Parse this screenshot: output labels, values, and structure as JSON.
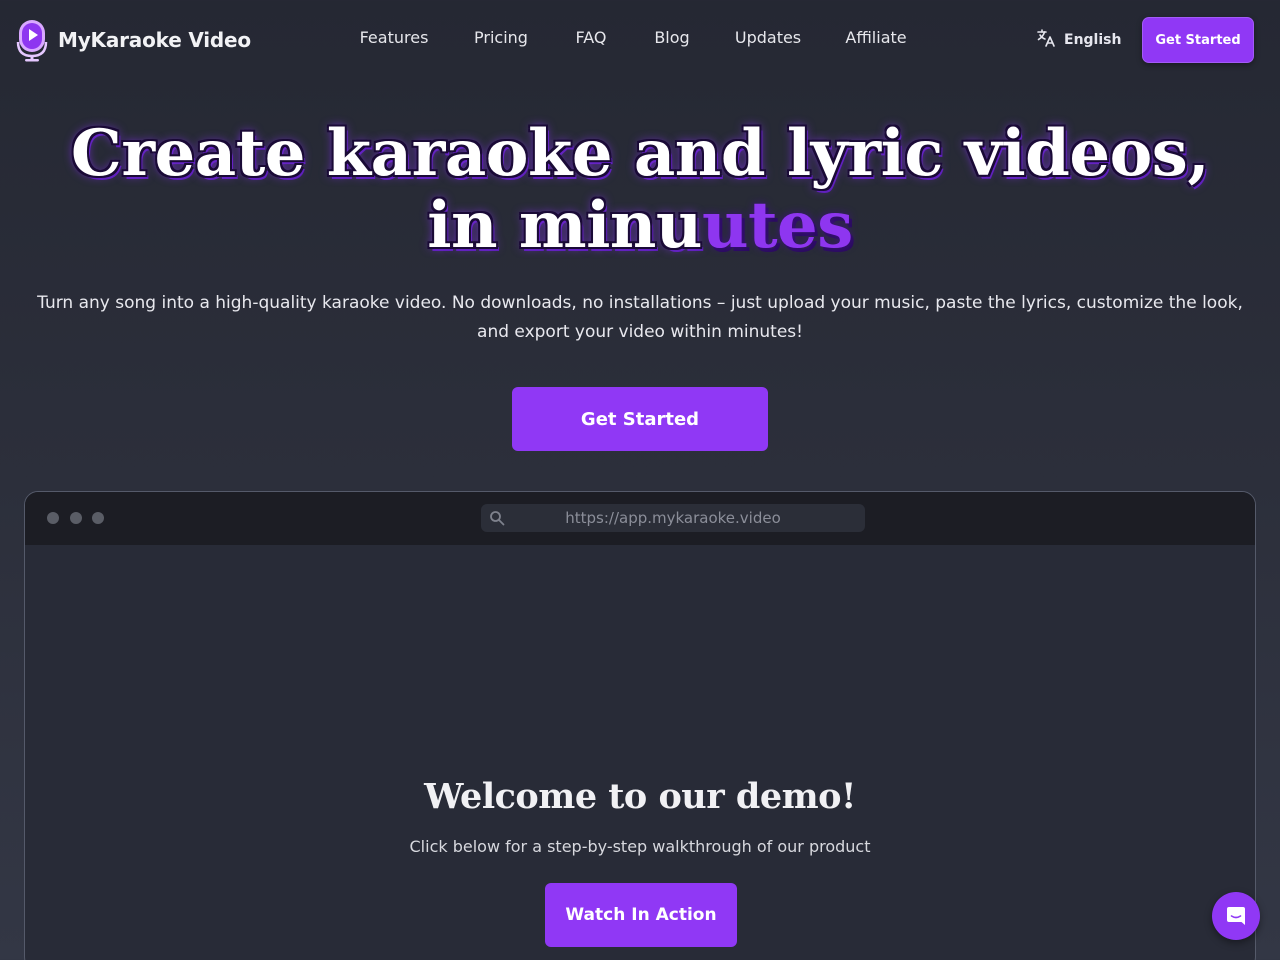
{
  "header": {
    "brand": "MyKaraoke Video",
    "nav": [
      "Features",
      "Pricing",
      "FAQ",
      "Blog",
      "Updates",
      "Affiliate"
    ],
    "language": "English",
    "cta_label": "Get Started"
  },
  "hero": {
    "title_line1": "Create karaoke and lyric videos,",
    "title_line2_plain": "in minu",
    "title_line2_accent": "utes",
    "subtitle": "Turn any song into a high-quality karaoke video. No downloads, no installations – just upload your music, paste the lyrics, customize the look, and export your video within minutes!",
    "cta_label": "Get Started"
  },
  "demo": {
    "url": "https://app.mykaraoke.video",
    "title": "Welcome to our demo!",
    "subtitle": "Click below for a step-by-step walkthrough of our product",
    "cta_label": "Watch In Action"
  },
  "icons": {
    "logo": "microphone-play-icon",
    "language": "translate-icon",
    "search": "search-icon",
    "chat": "chat-bubble-icon"
  },
  "colors": {
    "accent": "#9038f5",
    "background": "#2c2f3b"
  }
}
